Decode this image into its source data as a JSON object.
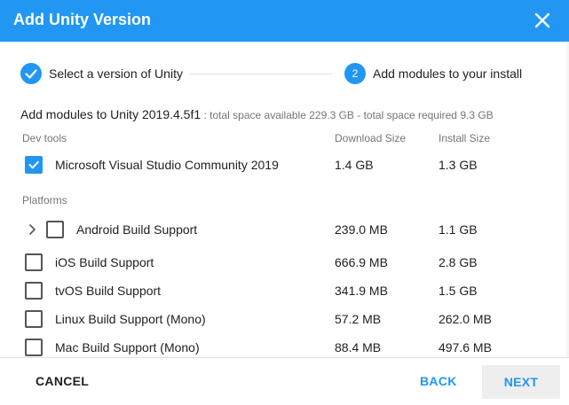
{
  "window": {
    "title": "Add Unity Version"
  },
  "stepper": {
    "step1": {
      "label": "Select a version of Unity",
      "done": true
    },
    "step2": {
      "number": "2",
      "label": "Add modules to your install"
    }
  },
  "summary": {
    "main": "Add modules to Unity 2019.4.5f1",
    "detail": " : total space available 229.3 GB - total space required 9.3 GB"
  },
  "columns": {
    "download": "Download Size",
    "install": "Install Size"
  },
  "sections": {
    "dev_tools": "Dev tools",
    "platforms": "Platforms"
  },
  "dev_tools": [
    {
      "name": "Microsoft Visual Studio Community 2019",
      "download": "1.4 GB",
      "install": "1.3 GB",
      "checked": true
    }
  ],
  "platforms": [
    {
      "name": "Android Build Support",
      "download": "239.0 MB",
      "install": "1.1 GB",
      "checked": false,
      "expandable": true
    },
    {
      "name": "iOS Build Support",
      "download": "666.9 MB",
      "install": "2.8 GB",
      "checked": false
    },
    {
      "name": "tvOS Build Support",
      "download": "341.9 MB",
      "install": "1.5 GB",
      "checked": false
    },
    {
      "name": "Linux Build Support (Mono)",
      "download": "57.2 MB",
      "install": "262.0 MB",
      "checked": false
    },
    {
      "name": "Mac Build Support (Mono)",
      "download": "88.4 MB",
      "install": "497.6 MB",
      "checked": false
    }
  ],
  "footer": {
    "cancel": "CANCEL",
    "back": "BACK",
    "next": "NEXT"
  },
  "colors": {
    "accent": "#2196f3"
  }
}
